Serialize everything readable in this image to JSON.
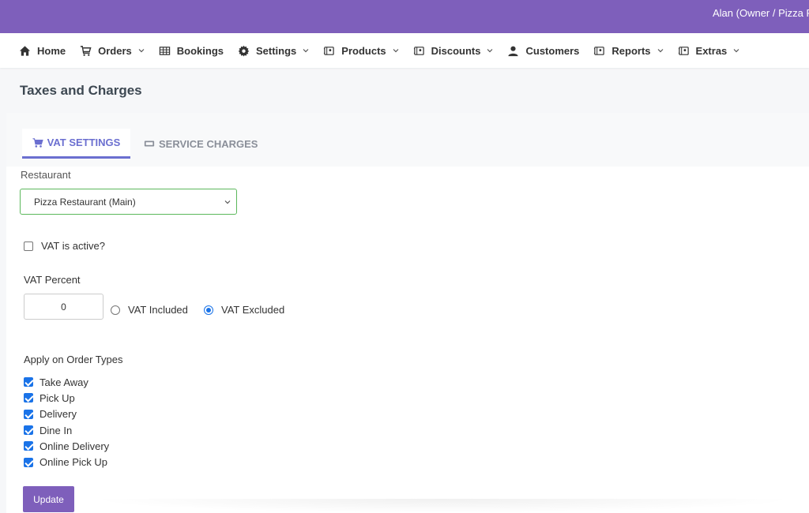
{
  "topbar": {
    "user": "Alan (Owner / Pizza R"
  },
  "nav": {
    "items": [
      {
        "label": "Home",
        "icon": "home-icon",
        "dropdown": false
      },
      {
        "label": "Orders",
        "icon": "cart-icon",
        "dropdown": true
      },
      {
        "label": "Bookings",
        "icon": "table-icon",
        "dropdown": false
      },
      {
        "label": "Settings",
        "icon": "gear-icon",
        "dropdown": true
      },
      {
        "label": "Products",
        "icon": "tag-icon",
        "dropdown": true
      },
      {
        "label": "Discounts",
        "icon": "tag-icon",
        "dropdown": true
      },
      {
        "label": "Customers",
        "icon": "user-icon",
        "dropdown": false
      },
      {
        "label": "Reports",
        "icon": "tag-icon",
        "dropdown": true
      },
      {
        "label": "Extras",
        "icon": "tag-icon",
        "dropdown": true
      }
    ]
  },
  "page": {
    "title": "Taxes and Charges"
  },
  "tabs": {
    "vat": {
      "label": "VAT SETTINGS",
      "active": true
    },
    "service": {
      "label": "SERVICE CHARGES",
      "active": false
    }
  },
  "form": {
    "restaurant_label": "Restaurant",
    "restaurant_value": "Pizza Restaurant (Main)",
    "vat_active_label": "VAT is active?",
    "vat_active_checked": false,
    "vat_percent_label": "VAT Percent",
    "vat_percent_value": "0",
    "vat_included_label": "VAT Included",
    "vat_excluded_label": "VAT Excluded",
    "vat_mode": "excluded",
    "apply_label": "Apply on Order Types",
    "order_types": [
      {
        "label": "Take Away",
        "checked": true
      },
      {
        "label": "Pick Up",
        "checked": true
      },
      {
        "label": "Delivery",
        "checked": true
      },
      {
        "label": "Dine In",
        "checked": true
      },
      {
        "label": "Online Delivery",
        "checked": true
      },
      {
        "label": "Online Pick Up",
        "checked": true
      }
    ],
    "update_label": "Update"
  },
  "colors": {
    "brand": "#7e5fbb",
    "tab_active": "#6b6fd0",
    "select_border": "#5cb85c",
    "check": "#1a73e8"
  }
}
